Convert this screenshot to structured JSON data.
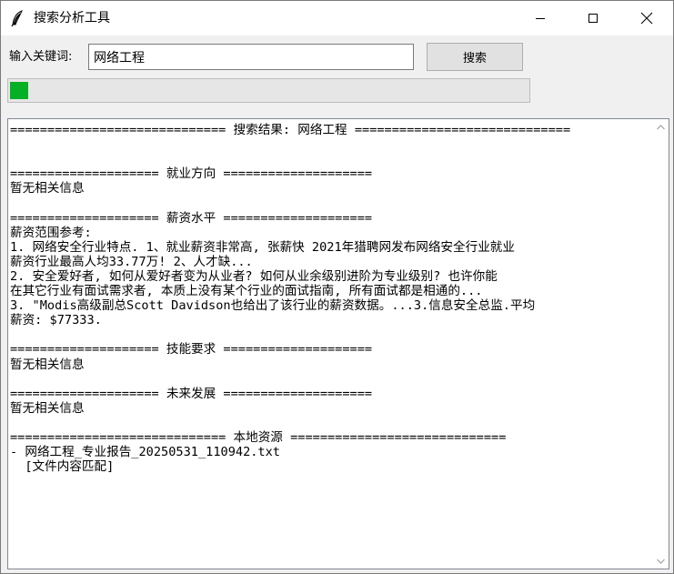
{
  "window": {
    "title": "搜索分析工具"
  },
  "search": {
    "label": "输入关键词:",
    "value": "网络工程",
    "button_label": "搜索"
  },
  "progress": {
    "percent": 3.5,
    "color": "#06b025"
  },
  "results": {
    "lines": [
      "============================= 搜索结果: 网络工程 =============================",
      "",
      "",
      "==================== 就业方向 ====================",
      "暂无相关信息",
      "",
      "==================== 薪资水平 ====================",
      "薪资范围参考:",
      "1. 网络安全行业特点. 1、就业薪资非常高, 张薪快 2021年猎聘网发布网络安全行业就业",
      "薪资行业最高人均33.77万! 2、人才缺...",
      "2. 安全爱好者, 如何从爱好者变为从业者? 如何从业余级别进阶为专业级别? 也许你能",
      "在其它行业有面试需求者, 本质上没有某个行业的面试指南, 所有面试都是相通的...",
      "3. \"Modis高级副总Scott Davidson也给出了该行业的薪资数据。...3.信息安全总监.平均",
      "薪资: $77333.",
      "",
      "==================== 技能要求 ====================",
      "暂无相关信息",
      "",
      "==================== 未来发展 ====================",
      "暂无相关信息",
      "",
      "============================= 本地资源 =============================",
      "- 网络工程_专业报告_20250531_110942.txt",
      "  [文件内容匹配]"
    ]
  },
  "icons": {
    "app": "feather-icon",
    "minimize": "minimize-icon",
    "maximize": "maximize-icon",
    "close": "close-icon",
    "scroll_up": "chevron-up-icon",
    "scroll_down": "chevron-down-icon"
  }
}
